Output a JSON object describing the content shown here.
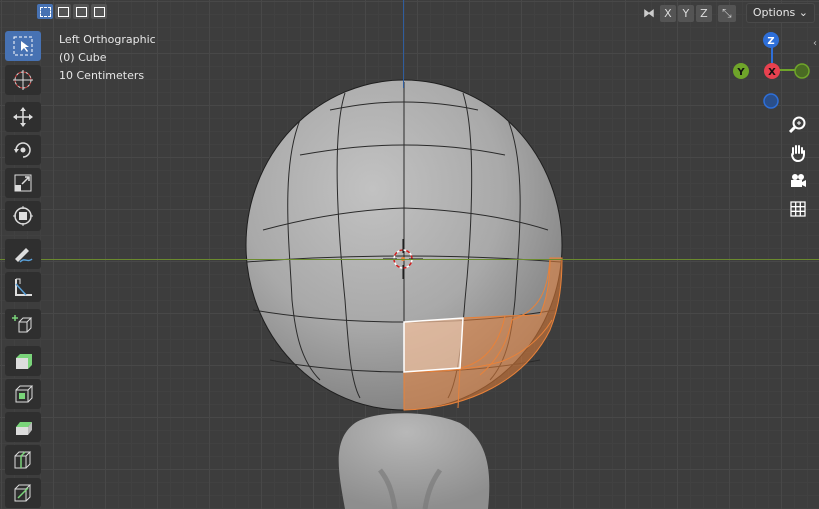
{
  "header": {
    "select_modes": [
      "new",
      "extend",
      "subtract",
      "intersect"
    ],
    "axis_toggles": [
      "X",
      "Y",
      "Z"
    ],
    "options_label": "Options ⌄"
  },
  "viewport": {
    "view_name": "Left Orthographic",
    "object_info": "(0) Cube",
    "grid_scale": "10 Centimeters",
    "colors": {
      "background": "#3d3d3d",
      "selection": "#e8823a",
      "active_face": "#ffffff",
      "x_axis": "#6b8a2e",
      "z_axis": "#2f5d9e"
    }
  },
  "gizmo": {
    "z_label": "Z",
    "y_label": "Y",
    "x_label": "X",
    "colors": {
      "z": "#2e6fd9",
      "y": "#6fa52a",
      "x": "#e8414f"
    }
  },
  "toolbar": {
    "tools": [
      "select-box",
      "cursor",
      "move",
      "rotate",
      "scale",
      "transform",
      "annotate",
      "measure",
      "add-cube",
      "extrude-region",
      "inset-faces",
      "bevel",
      "loop-cut",
      "knife"
    ]
  },
  "nav_buttons": [
    "zoom",
    "pan",
    "camera",
    "ortho-toggle"
  ]
}
